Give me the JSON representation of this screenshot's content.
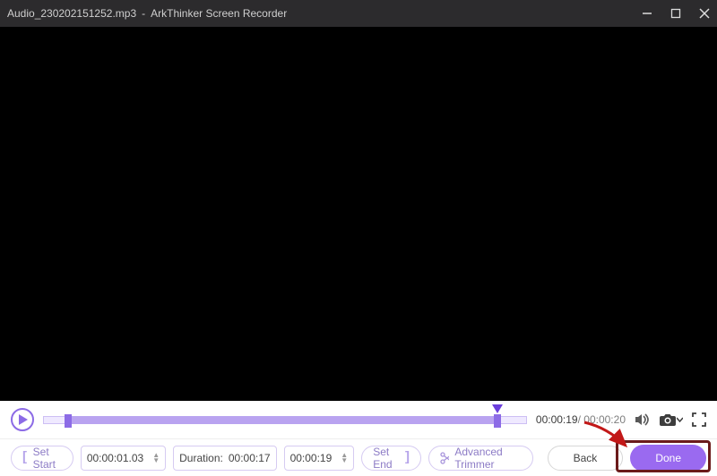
{
  "titlebar": {
    "filename": "Audio_230202151252.mp3",
    "sep": "-",
    "app": "ArkThinker Screen Recorder"
  },
  "playback": {
    "current": "00:00:19",
    "total": "00:00:20"
  },
  "trim": {
    "set_start_label": "Set Start",
    "start_time": "00:00:01.03",
    "duration_label": "Duration:",
    "duration_value": "00:00:17",
    "end_time": "00:00:19",
    "set_end_label": "Set End",
    "advanced_label": "Advanced Trimmer"
  },
  "buttons": {
    "back": "Back",
    "done": "Done"
  }
}
